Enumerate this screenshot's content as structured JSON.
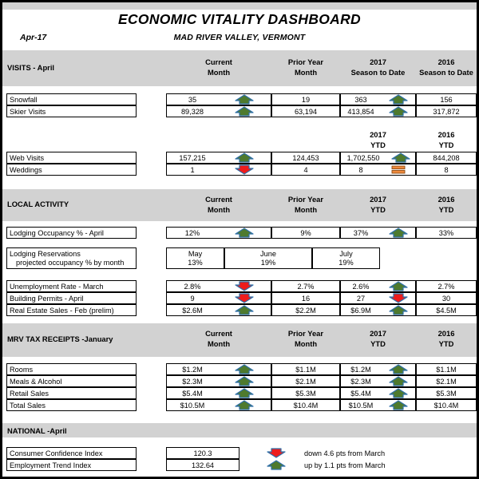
{
  "header": {
    "title": "ECONOMIC VITALITY DASHBOARD",
    "subtitle": "MAD RIVER VALLEY, VERMONT",
    "period": "Apr-17"
  },
  "column_headers": {
    "current_month": {
      "line1": "Current",
      "line2": "Month"
    },
    "prior_year_month": {
      "line1": "Prior Year",
      "line2": "Month"
    },
    "season_2017": {
      "line1": "2017",
      "line2": "Season to Date"
    },
    "season_2016": {
      "line1": "2016",
      "line2": "Season to Date"
    },
    "ytd_2017": {
      "line1": "2017",
      "line2": "YTD"
    },
    "ytd_2016": {
      "line1": "2016",
      "line2": "YTD"
    }
  },
  "sections": {
    "visits": {
      "title": "VISITS - April"
    },
    "local_activity": {
      "title": "LOCAL ACTIVITY"
    },
    "tax_receipts": {
      "title": "MRV TAX RECEIPTS -January"
    },
    "national": {
      "title": "NATIONAL -April"
    }
  },
  "rows": {
    "snowfall": {
      "label": "Snowfall",
      "current": "35",
      "trend_current": "up",
      "prior": "19",
      "ytd_2017": "363",
      "trend_ytd": "up",
      "ytd_2016": "156"
    },
    "skier_visits": {
      "label": "Skier Visits",
      "current": "89,328",
      "trend_current": "up",
      "prior": "63,194",
      "ytd_2017": "413,854",
      "trend_ytd": "up",
      "ytd_2016": "317,872"
    },
    "web_visits": {
      "label": "Web Visits",
      "current": "157,215",
      "trend_current": "up",
      "prior": "124,453",
      "ytd_2017": "1,702,550",
      "trend_ytd": "up",
      "ytd_2016": "844,208"
    },
    "weddings": {
      "label": "Weddings",
      "current": "1",
      "trend_current": "down",
      "prior": "4",
      "ytd_2017": "8",
      "trend_ytd": "flat",
      "ytd_2016": "8"
    },
    "lodging_occupancy": {
      "label": "Lodging Occupancy % - April",
      "current": "12%",
      "trend_current": "up",
      "prior": "9%",
      "ytd_2017": "37%",
      "trend_ytd": "up",
      "ytd_2016": "33%"
    },
    "unemployment": {
      "label": "Unemployment Rate - March",
      "current": "2.8%",
      "trend_current": "down",
      "prior": "2.7%",
      "ytd_2017": "2.6%",
      "trend_ytd": "up",
      "ytd_2016": "2.7%"
    },
    "building_permits": {
      "label": "Building Permits - April",
      "current": "9",
      "trend_current": "down",
      "prior": "16",
      "ytd_2017": "27",
      "trend_ytd": "down",
      "ytd_2016": "30"
    },
    "real_estate": {
      "label": "Real Estate Sales - Feb (prelim)",
      "current": "$2.6M",
      "trend_current": "up",
      "prior": "$2.2M",
      "ytd_2017": "$6.9M",
      "trend_ytd": "up",
      "ytd_2016": "$4.5M"
    },
    "rooms": {
      "label": "Rooms",
      "current": "$1.2M",
      "trend_current": "up",
      "prior": "$1.1M",
      "ytd_2017": "$1.2M",
      "trend_ytd": "up",
      "ytd_2016": "$1.1M"
    },
    "meals_alcohol": {
      "label": "Meals & Alcohol",
      "current": "$2.3M",
      "trend_current": "up",
      "prior": "$2.1M",
      "ytd_2017": "$2.3M",
      "trend_ytd": "up",
      "ytd_2016": "$2.1M"
    },
    "retail_sales": {
      "label": "Retail Sales",
      "current": "$5.4M",
      "trend_current": "up",
      "prior": "$5.3M",
      "ytd_2017": "$5.4M",
      "trend_ytd": "up",
      "ytd_2016": "$5.3M"
    },
    "total_sales": {
      "label": "Total Sales",
      "current": "$10.5M",
      "trend_current": "up",
      "prior": "$10.4M",
      "ytd_2017": "$10.5M",
      "trend_ytd": "up",
      "ytd_2016": "$10.4M"
    }
  },
  "lodging_reservations": {
    "label_line1": "Lodging Reservations",
    "label_line2": "projected occupancy % by month",
    "months": [
      {
        "month": "May",
        "value": "13%"
      },
      {
        "month": "June",
        "value": "19%"
      },
      {
        "month": "July",
        "value": "19%"
      }
    ]
  },
  "national": {
    "consumer_confidence": {
      "label": "Consumer Confidence Index",
      "value": "120.3",
      "trend": "down",
      "note": "down 4.6 pts from March"
    },
    "employment_trend": {
      "label": "Employment Trend Index",
      "value": "132.64",
      "trend": "up",
      "note": "up by 1.1 pts from March"
    }
  },
  "colors": {
    "band_gray": "#d2d2d2",
    "arrow_up_fill": "#4e7a2e",
    "arrow_down_fill": "#ee1c1c",
    "arrow_outline": "#2f6fa8",
    "flat_fill": "#f08a3c",
    "border": "#000000"
  },
  "icons": {
    "up": "arrow-up-icon",
    "down": "arrow-down-icon",
    "flat": "flat-equal-icon"
  }
}
